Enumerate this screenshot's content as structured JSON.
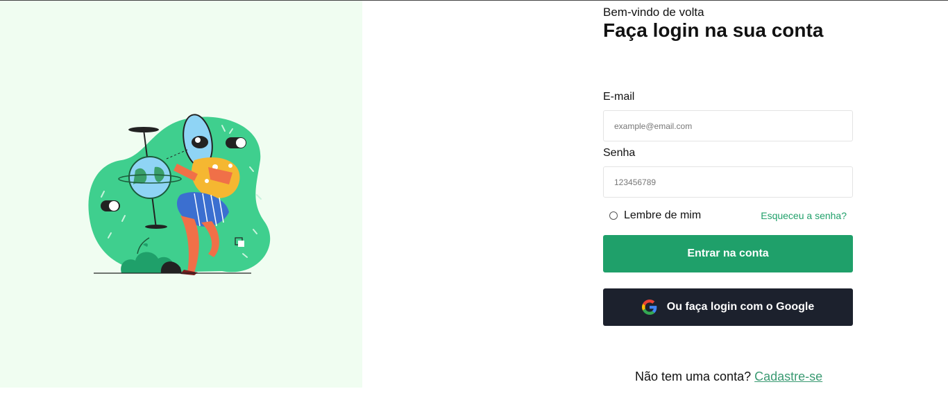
{
  "colors": {
    "hero_background": "#f0fdf1",
    "accent_green": "#1fa06a",
    "google_button": "#1c212d",
    "link_green": "#20a06a"
  },
  "hero": {
    "illustration": "person-with-magnifying-glass-and-globe"
  },
  "header": {
    "welcome": "Bem-vindo de volta",
    "title": "Faça login na sua conta"
  },
  "form": {
    "email_label": "E-mail",
    "email_placeholder": "example@email.com",
    "password_label": "Senha",
    "password_placeholder": "123456789",
    "remember_label": "Lembre de mim",
    "forgot_link": "Esqueceu a senha?",
    "submit_label": "Entrar na conta",
    "google_label": "Ou faça login com o Google",
    "google_icon": "google-icon"
  },
  "footer": {
    "prompt": "Não tem uma conta?",
    "signup_link": "Cadastre-se"
  }
}
